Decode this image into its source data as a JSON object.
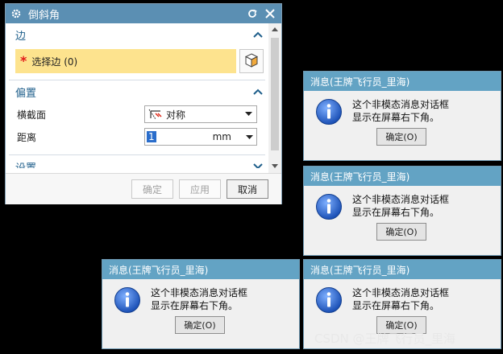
{
  "dialog": {
    "title": "倒斜角",
    "edge_section": {
      "label": "边",
      "select_label": "选择边 (0)"
    },
    "offset_section": {
      "label": "偏置",
      "cross_section_label": "横截面",
      "cross_section_value": "对称",
      "distance_label": "距离",
      "distance_value": "1",
      "distance_unit": "mm"
    },
    "settings_section": {
      "label": "设置"
    },
    "buttons": {
      "ok": "确定",
      "apply": "应用",
      "cancel": "取消"
    }
  },
  "messages": [
    {
      "title": "消息(王牌飞行员_里海)",
      "line1": "这个非模态消息对话框",
      "line2": "显示在屏幕右下角。",
      "ok": "确定(O)"
    },
    {
      "title": "消息(王牌飞行员_里海)",
      "line1": "这个非模态消息对话框",
      "line2": "显示在屏幕右下角。",
      "ok": "确定(O)"
    },
    {
      "title": "消息(王牌飞行员_里海)",
      "line1": "这个非模态消息对话框",
      "line2": "显示在屏幕右下角。",
      "ok": "确定(O)"
    },
    {
      "title": "消息(王牌飞行员_里海)",
      "line1": "这个非模态消息对话框",
      "line2": "显示在屏幕右下角。",
      "ok": "确定(O)"
    }
  ],
  "watermark": "CSDN @王牌飞行员_里海",
  "colors": {
    "titlebar": "#5b8fb3",
    "message_titlebar": "#63a3c4",
    "selection_highlight": "#fde38e",
    "required_star": "#e21a1a"
  }
}
